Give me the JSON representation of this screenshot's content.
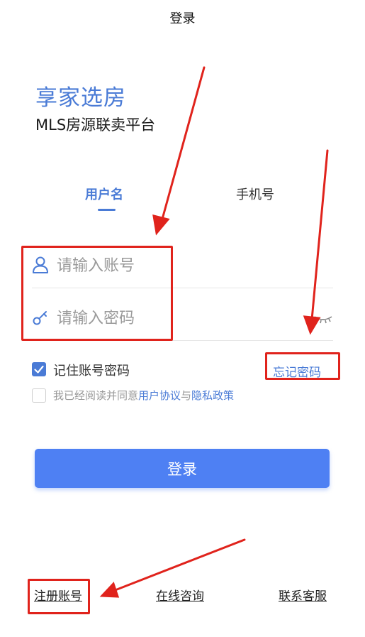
{
  "header": {
    "title": "登录"
  },
  "brand": {
    "title": "享家选房",
    "subtitle": "MLS房源联卖平台"
  },
  "tabs": [
    {
      "label": "用户名"
    },
    {
      "label": "手机号"
    }
  ],
  "form": {
    "account_placeholder": "请输入账号",
    "password_placeholder": "请输入密码",
    "remember_label": "记住账号密码",
    "forgot_label": "忘记密码",
    "agree_prefix": "我已经阅读并同意",
    "agree_user_agreement": "用户协议",
    "agree_and": "与",
    "agree_privacy": "隐私政策",
    "submit_label": "登录"
  },
  "footer": {
    "register": "注册账号",
    "consult": "在线咨询",
    "service": "联系客服"
  },
  "colors": {
    "accent": "#4a7bd6",
    "button": "#4e80f3",
    "annotation": "#e0231c"
  },
  "icons": [
    "user-icon",
    "key-icon",
    "eye-closed-icon",
    "checkmark-icon"
  ]
}
